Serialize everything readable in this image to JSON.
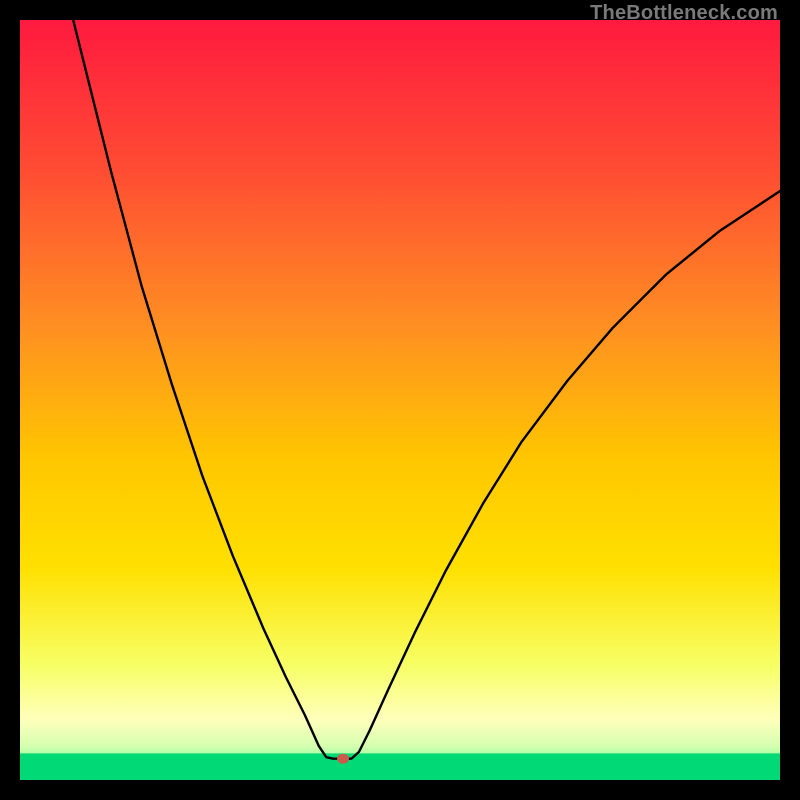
{
  "watermark": "TheBottleneck.com",
  "chart_data": {
    "type": "line",
    "title": "",
    "xlabel": "",
    "ylabel": "",
    "xlim": [
      0,
      100
    ],
    "ylim": [
      0,
      100
    ],
    "grid": false,
    "legend": false,
    "gradient_stops": [
      {
        "offset": 0.0,
        "color": "#ff1a3f"
      },
      {
        "offset": 0.2,
        "color": "#ff4d33"
      },
      {
        "offset": 0.4,
        "color": "#ff8e22"
      },
      {
        "offset": 0.58,
        "color": "#ffc700"
      },
      {
        "offset": 0.72,
        "color": "#ffe000"
      },
      {
        "offset": 0.85,
        "color": "#f7ff66"
      },
      {
        "offset": 0.92,
        "color": "#ffffbb"
      },
      {
        "offset": 0.955,
        "color": "#d6ffb0"
      },
      {
        "offset": 0.975,
        "color": "#8fff9e"
      },
      {
        "offset": 0.99,
        "color": "#33ee88"
      },
      {
        "offset": 1.0,
        "color": "#00d976"
      }
    ],
    "bottom_band": {
      "y_from": 96.5,
      "y_to": 100,
      "color": "#00d976"
    },
    "marker": {
      "x": 42.5,
      "y": 97.2,
      "color": "#cc5a4a",
      "rx": 6,
      "ry": 5
    },
    "series": [
      {
        "name": "bottleneck-curve",
        "stroke": "#000000",
        "stroke_width": 2.4,
        "points": [
          {
            "x": 7.0,
            "y": 0.0
          },
          {
            "x": 9.0,
            "y": 8.0
          },
          {
            "x": 12.0,
            "y": 20.0
          },
          {
            "x": 16.0,
            "y": 35.0
          },
          {
            "x": 20.0,
            "y": 48.0
          },
          {
            "x": 24.0,
            "y": 60.0
          },
          {
            "x": 28.0,
            "y": 70.5
          },
          {
            "x": 32.0,
            "y": 80.0
          },
          {
            "x": 35.0,
            "y": 86.5
          },
          {
            "x": 37.5,
            "y": 91.5
          },
          {
            "x": 39.3,
            "y": 95.5
          },
          {
            "x": 40.3,
            "y": 97.0
          },
          {
            "x": 41.2,
            "y": 97.2
          },
          {
            "x": 43.6,
            "y": 97.2
          },
          {
            "x": 44.6,
            "y": 96.3
          },
          {
            "x": 46.0,
            "y": 93.5
          },
          {
            "x": 48.5,
            "y": 88.0
          },
          {
            "x": 52.0,
            "y": 80.5
          },
          {
            "x": 56.0,
            "y": 72.5
          },
          {
            "x": 61.0,
            "y": 63.5
          },
          {
            "x": 66.0,
            "y": 55.5
          },
          {
            "x": 72.0,
            "y": 47.5
          },
          {
            "x": 78.0,
            "y": 40.5
          },
          {
            "x": 85.0,
            "y": 33.5
          },
          {
            "x": 92.0,
            "y": 27.8
          },
          {
            "x": 100.0,
            "y": 22.5
          }
        ]
      }
    ]
  }
}
